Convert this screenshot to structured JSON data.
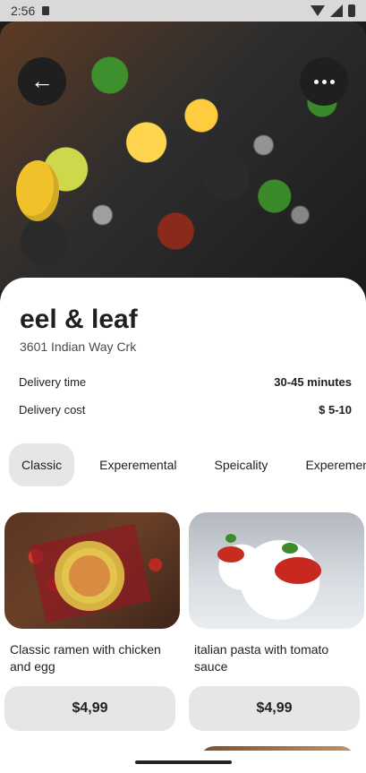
{
  "statusbar": {
    "time": "2:56"
  },
  "restaurant": {
    "name": "eel & leaf",
    "address": "3601 Indian Way Crk"
  },
  "details": {
    "delivery_time_label": "Delivery time",
    "delivery_time_value": "30-45 minutes",
    "delivery_cost_label": "Delivery cost",
    "delivery_cost_value": "$ 5-10"
  },
  "tabs": [
    {
      "label": "Classic",
      "active": true
    },
    {
      "label": "Experemental",
      "active": false
    },
    {
      "label": "Speicality",
      "active": false
    },
    {
      "label": "Experemental",
      "active": false
    }
  ],
  "dishes": [
    {
      "name": "Classic ramen with chicken and egg",
      "price": "$4,99"
    },
    {
      "name": "italian pasta with tomato sauce",
      "price": "$4,99"
    }
  ],
  "icons": {
    "back": "arrow-left-icon",
    "more": "more-horizontal-icon"
  }
}
